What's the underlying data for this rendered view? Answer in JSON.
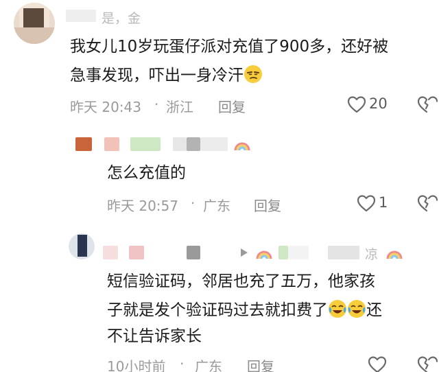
{
  "comments": [
    {
      "username_visible": "是，金",
      "text_line1": "我女儿10岁玩蛋仔派对充值了900多，还好被",
      "text_line2": "急事发现，吓出一身冷汗",
      "emoji": "smirk-emoji",
      "time": "昨天 20:43",
      "separator": "·",
      "location": "浙江",
      "reply_label": "回复",
      "likes": "20"
    },
    {
      "text": "怎么充值的",
      "time": "昨天 20:57",
      "separator": "·",
      "location": "广东",
      "reply_label": "回复",
      "likes": "1"
    },
    {
      "username_visible": "凉",
      "text_line1": "短信验证码，邻居也充了五万，他家孩",
      "text_line2": "子就是发个验证码过去就扣费了",
      "text_line2_suffix": "还",
      "emoji": "crying-laughing-emoji",
      "text_line3": "不让告诉家长",
      "time": "10小时前",
      "separator": "·",
      "location": "广东",
      "reply_label": "回复"
    }
  ],
  "colors": {
    "text": "#1b1b1b",
    "meta": "#9a9a9a",
    "icon": "#6a6a6a"
  }
}
